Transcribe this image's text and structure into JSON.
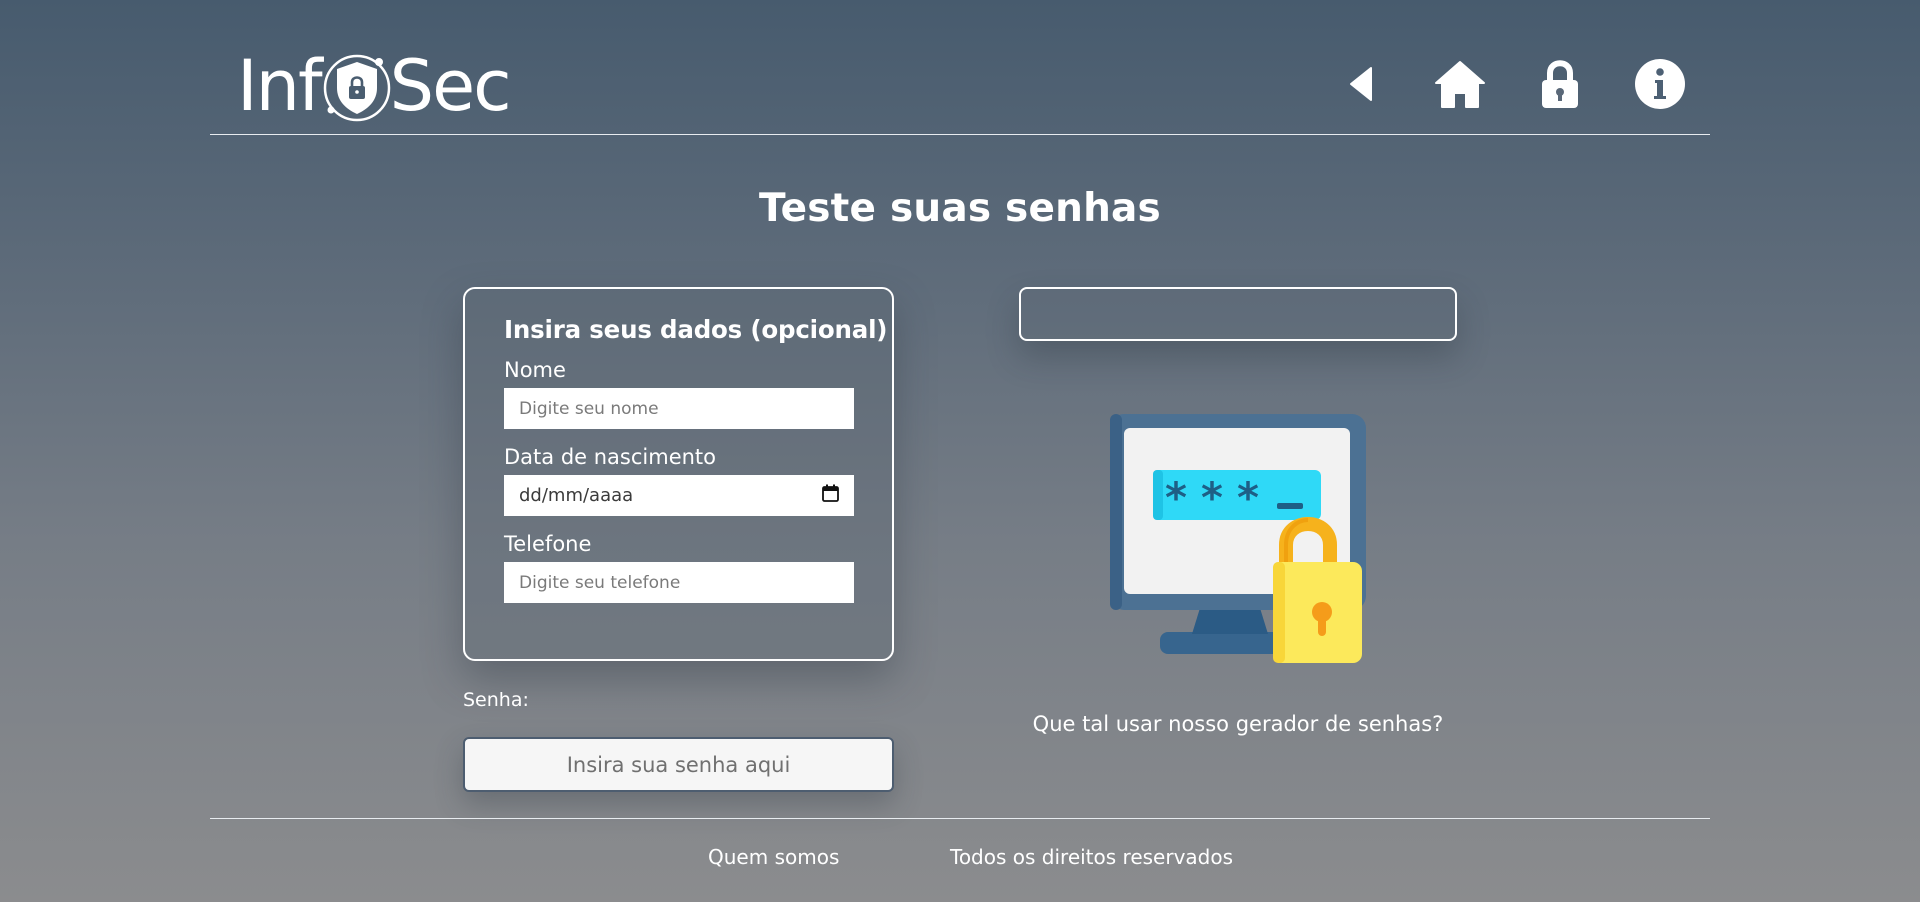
{
  "header": {
    "logo": {
      "prefix": "Inf",
      "suffix": "Sec"
    },
    "nav": [
      {
        "name": "back-icon"
      },
      {
        "name": "home-icon"
      },
      {
        "name": "lock-icon"
      },
      {
        "name": "info-icon"
      }
    ]
  },
  "main": {
    "title": "Teste suas senhas",
    "form": {
      "heading": "Insira seus dados (opcional)",
      "name_label": "Nome",
      "name_placeholder": "Digite seu nome",
      "birth_label": "Data de nascimento",
      "birth_placeholder": "dd/mm/aaaa",
      "phone_label": "Telefone",
      "phone_placeholder": "Digite seu telefone"
    },
    "password": {
      "label": "Senha:",
      "placeholder": "Insira sua senha aqui"
    },
    "result": {
      "value": ""
    },
    "illustration_icon": "password-monitor-lock-icon",
    "generator_link": "Que tal usar nosso gerador de senhas?"
  },
  "footer": {
    "about": "Quem somos",
    "rights": "Todos os direitos reservados"
  },
  "colors": {
    "background_top": "#475b6e",
    "background_bottom": "#8b8c8e",
    "password_field_border": "#4d5d70",
    "padlock_yellow": "#fce95b",
    "padlock_shackle": "#f6b21c",
    "monitor_blue": "#4c7193",
    "password_bar_cyan": "#2fd9f7"
  }
}
